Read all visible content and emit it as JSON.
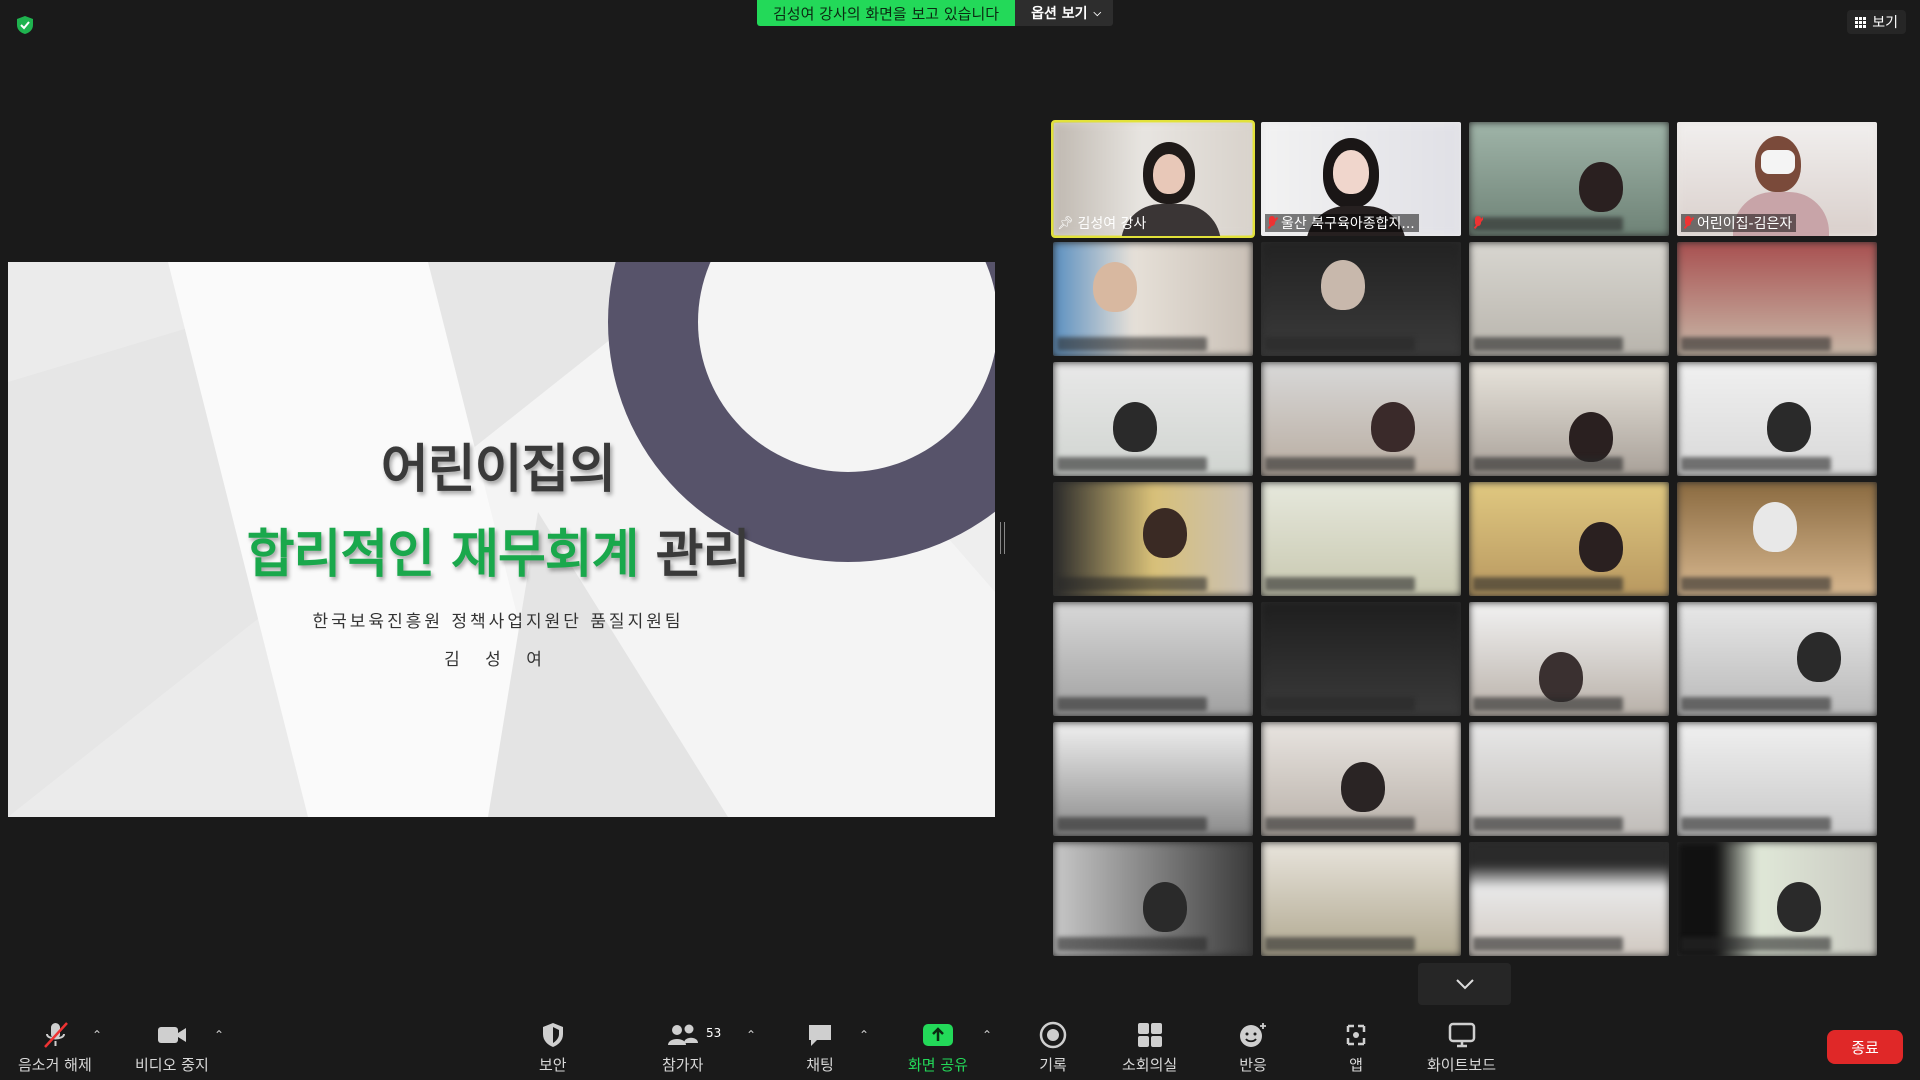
{
  "top": {
    "share_banner": "김성여 강사의 화면을 보고 있습니다",
    "view_options": "옵션 보기",
    "view_button": "보기"
  },
  "slide": {
    "title_line1": "어린이집의",
    "title_line2_green": "합리적인 재무회계",
    "title_line2_dark": " 관리",
    "subtitle": "한국보육진흥원 정책사업지원단 품질지원팀",
    "author": "김 성 여",
    "accent_color": "#1aa84c",
    "shape_color": "#57536a"
  },
  "gallery": {
    "tiles": [
      {
        "label": "김성여 강사",
        "pinned": true,
        "muted": false
      },
      {
        "label": "울산 북구육아종합지...",
        "pinned": false,
        "muted": true
      },
      {
        "label": "",
        "pinned": false,
        "muted": true
      },
      {
        "label": "어린이집-김은자",
        "pinned": false,
        "muted": true
      }
    ]
  },
  "toolbar": {
    "unmute": "음소거 해제",
    "stop_video": "비디오 중지",
    "security": "보안",
    "participants": "참가자",
    "participant_count": "53",
    "chat": "채팅",
    "share_screen": "화면 공유",
    "record": "기록",
    "breakout": "소회의실",
    "reactions": "반응",
    "apps": "앱",
    "whiteboard": "화이트보드",
    "end": "종료"
  },
  "colors": {
    "share_green": "#23d959",
    "end_red": "#e02828",
    "active_speaker": "#e2e23a"
  }
}
